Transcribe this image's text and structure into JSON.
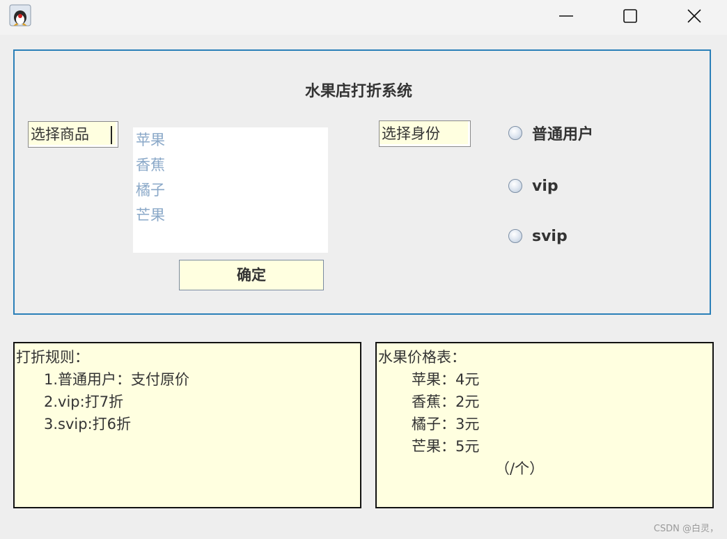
{
  "window": {
    "minimize": "minimize",
    "maximize": "maximize",
    "close": "close"
  },
  "panel": {
    "title": "水果店打折系统",
    "goods_label": "选择商品",
    "identity_label": "选择身份",
    "fruit_list": [
      "苹果",
      "香蕉",
      "橘子",
      "芒果"
    ],
    "confirm_button": "确定",
    "identity_options": [
      "普通用户",
      "vip",
      "svip"
    ]
  },
  "rules": {
    "title": "打折规则：",
    "lines": [
      "1.普通用户：支付原价",
      "2.vip:打7折",
      "3.svip:打6折"
    ]
  },
  "prices": {
    "title": "水果价格表：",
    "lines": [
      "苹果：4元",
      "香蕉：2元",
      "橘子：3元",
      "芒果：5元"
    ],
    "unit": "（/个）"
  },
  "watermark": "CSDN @白灵，",
  "colors": {
    "panel_border": "#2a7fb8",
    "label_bg": "#ffffe0",
    "list_text": "#8aa8c8",
    "window_bg": "#eeeeee"
  }
}
